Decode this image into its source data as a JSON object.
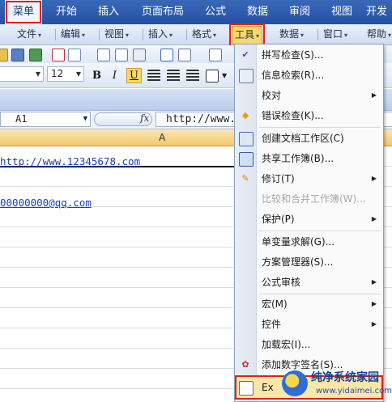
{
  "ribbon_tabs": [
    {
      "label": "菜单",
      "active": true
    },
    {
      "label": "开始"
    },
    {
      "label": "插入"
    },
    {
      "label": "页面布局"
    },
    {
      "label": "公式"
    },
    {
      "label": "数据"
    },
    {
      "label": "审阅"
    },
    {
      "label": "视图"
    },
    {
      "label": "开发"
    }
  ],
  "menu_bar": [
    {
      "label": "文件"
    },
    {
      "label": "编辑"
    },
    {
      "label": "视图"
    },
    {
      "label": "插入"
    },
    {
      "label": "格式"
    },
    {
      "label": "工具",
      "active": true
    },
    {
      "label": "数据"
    },
    {
      "label": "窗口"
    },
    {
      "label": "帮助"
    }
  ],
  "format_toolbar": {
    "font_size": "12",
    "bold": "B",
    "italic": "I",
    "underline": "U"
  },
  "formula_bar": {
    "name_box": "A1",
    "fx_label": "fx",
    "content": "http://www.1"
  },
  "sheet": {
    "column_header": "A",
    "cells": [
      {
        "row": 1,
        "text": "http://www.12345678.com"
      },
      {
        "row": 3,
        "text": "00000000@qq.com"
      }
    ]
  },
  "tools_menu": {
    "items": [
      {
        "label": "拼写检查(S)...",
        "icon": "spell-check-icon"
      },
      {
        "label": "信息检索(R)...",
        "icon": "research-icon"
      },
      {
        "label": "校对",
        "submenu": true
      },
      {
        "label": "错误检查(K)...",
        "icon": "error-check-icon"
      },
      {
        "separator": true
      },
      {
        "label": "创建文档工作区(C)",
        "icon": "workspace-icon"
      },
      {
        "label": "共享工作簿(B)...",
        "icon": "share-workbook-icon"
      },
      {
        "label": "修订(T)",
        "icon": "track-changes-icon",
        "submenu": true
      },
      {
        "label": "比较和合并工作簿(W)...",
        "disabled": true
      },
      {
        "label": "保护(P)",
        "submenu": true
      },
      {
        "separator": true
      },
      {
        "label": "单变量求解(G)..."
      },
      {
        "label": "方案管理器(S)..."
      },
      {
        "label": "公式审核",
        "submenu": true
      },
      {
        "separator": true
      },
      {
        "label": "宏(M)",
        "submenu": true
      },
      {
        "label": "控件",
        "submenu": true
      },
      {
        "label": "加载宏(I)..."
      },
      {
        "label": "添加数字签名(S)...",
        "icon": "signature-icon"
      },
      {
        "label": "Ex",
        "icon": "excel-options-icon",
        "highlighted": true
      }
    ]
  },
  "watermark": {
    "title": "纯净系统家园",
    "url": "www.yidaimei.com"
  },
  "colors": {
    "ribbon_blue": "#2c5cae",
    "highlight_red": "#e02020",
    "active_yellow": "#f7d86a",
    "link_blue": "#1b3fb8"
  }
}
